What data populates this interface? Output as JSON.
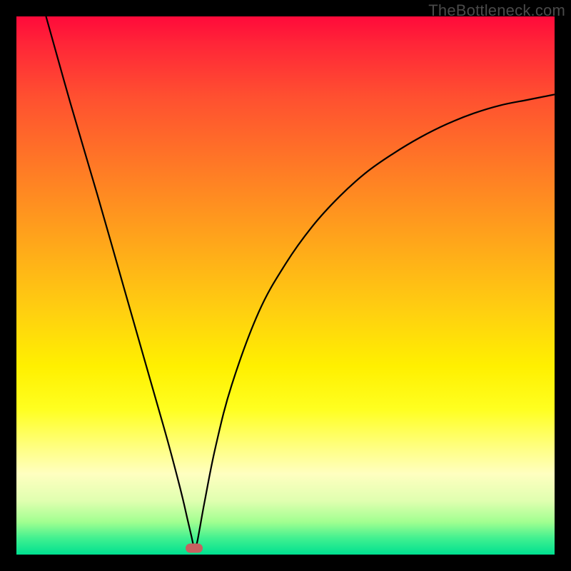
{
  "watermark": "TheBottleneck.com",
  "chart_data": {
    "type": "line",
    "title": "",
    "xlabel": "",
    "ylabel": "",
    "xlim": [
      0,
      100
    ],
    "ylim": [
      0,
      100
    ],
    "series": [
      {
        "name": "curve",
        "x": [
          5.5,
          10,
          15,
          20,
          25,
          28,
          30,
          31,
          31.8,
          32.5,
          33,
          33.5,
          34,
          35,
          37,
          40,
          45,
          50,
          55,
          60,
          65,
          70,
          75,
          80,
          85,
          90,
          95,
          100
        ],
        "y": [
          100,
          84,
          67,
          49.5,
          32,
          21.5,
          14,
          10,
          6.5,
          3.5,
          1.5,
          2,
          4.5,
          10,
          20,
          31.5,
          45,
          54,
          61,
          66.5,
          71,
          74.5,
          77.5,
          80,
          82,
          83.5,
          84.5,
          85.5
        ]
      }
    ],
    "marker": {
      "x": 33,
      "y": 1.2
    },
    "background": "rainbow-gradient-vertical"
  }
}
